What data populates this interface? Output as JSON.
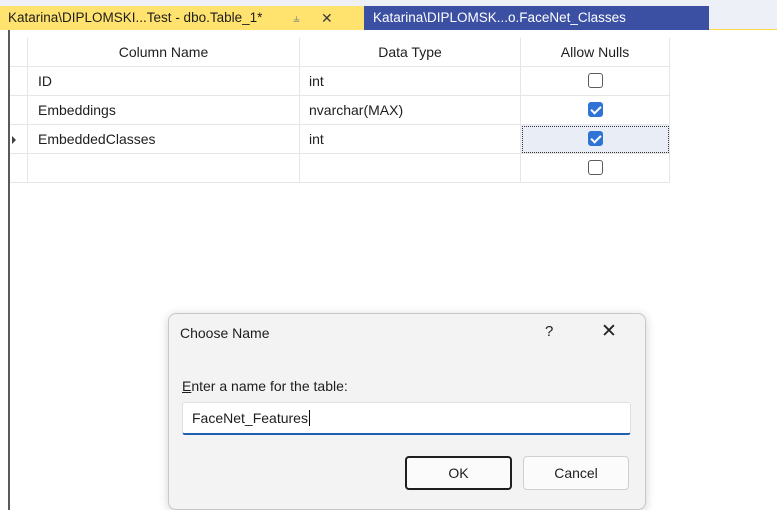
{
  "tabs": [
    {
      "label": "Katarina\\DIPLOMSKI...Test - dbo.Table_1*",
      "pin_glyph": "⫨",
      "close_glyph": "✕",
      "active": true
    },
    {
      "label": "Katarina\\DIPLOMSK...o.FaceNet_Classes",
      "active": false
    }
  ],
  "grid": {
    "headers": {
      "name": "Column Name",
      "type": "Data Type",
      "nulls": "Allow Nulls"
    },
    "rows": [
      {
        "name": "ID",
        "type": "int",
        "allow_nulls": false
      },
      {
        "name": "Embeddings",
        "type": "nvarchar(MAX)",
        "allow_nulls": true
      },
      {
        "name": "EmbeddedClasses",
        "type": "int",
        "allow_nulls": true,
        "current": true
      },
      {
        "name": "",
        "type": "",
        "allow_nulls": false
      }
    ]
  },
  "dialog": {
    "title": "Choose Name",
    "help_glyph": "?",
    "close_glyph": "✕",
    "prompt_mnemonic": "E",
    "prompt_rest": "nter a name for the table:",
    "input_value": "FaceNet_Features",
    "ok_label": "OK",
    "cancel_label": "Cancel"
  },
  "colors": {
    "accent": "#2f73d4",
    "tab_active": "#ffe36e",
    "tab_inactive": "#3b4fa3"
  }
}
